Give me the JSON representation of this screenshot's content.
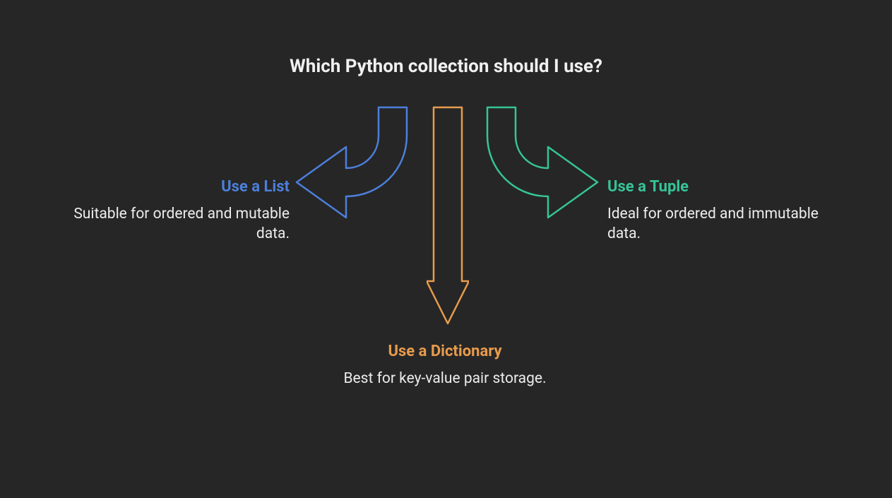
{
  "title": "Which Python collection should I use?",
  "colors": {
    "list": "#4d7fdb",
    "tuple": "#36c497",
    "dictionary": "#e89b4c"
  },
  "branches": {
    "left": {
      "heading": "Use a List",
      "description": "Suitable for ordered and mutable data."
    },
    "right": {
      "heading": "Use a Tuple",
      "description": "Ideal for ordered and immutable data."
    },
    "down": {
      "heading": "Use a Dictionary",
      "description": "Best for key-value pair storage."
    }
  }
}
